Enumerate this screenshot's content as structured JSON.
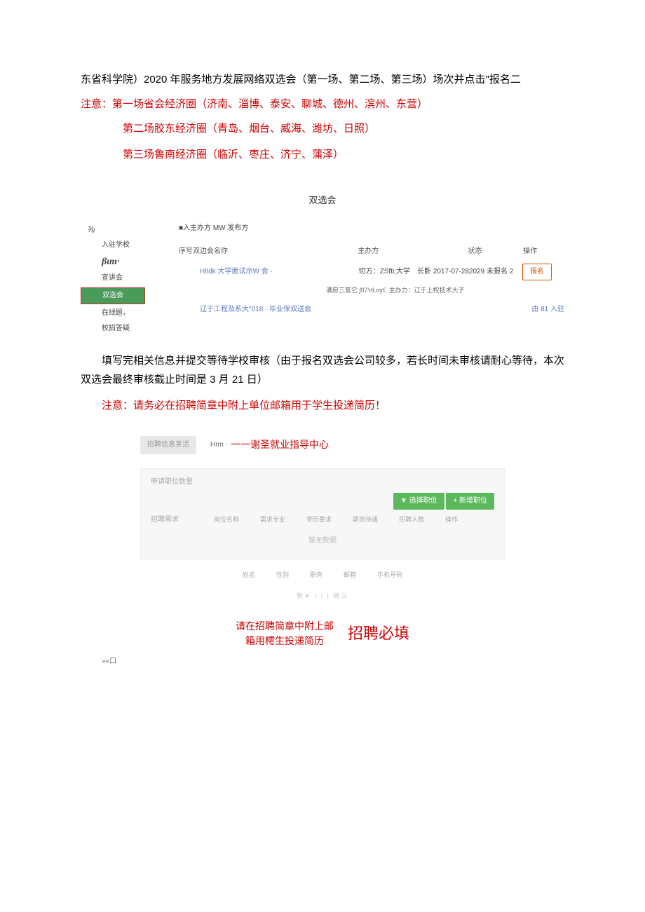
{
  "intro": {
    "line1": "东省科学院）2020 年服务地方发展网络双选会（第一场、第二场、第三场）场次并点击\"报名二",
    "notice_prefix": "注意：",
    "notice1": "第一场省会经济圈（济南、淄博、泰安、聊城、德州、滨州、东营）",
    "notice2": "第二场胶东经济圈（青岛、烟台、威海、潍坊、日照）",
    "notice3": "第三场鲁南经济圈（临沂、枣庄、济宁、蒲泽）"
  },
  "section_header": "双选会",
  "sidebar": {
    "fraction": "⅜",
    "item1": "入驻学校",
    "beta": "βιm·",
    "item2": "宣讲会",
    "active": "双选会",
    "item3": "在线题，",
    "item4": "校招答疑"
  },
  "table": {
    "filter_label": "■入主办方 MW 发布方",
    "h1": "序号双边会名你",
    "h2": "主办方",
    "h3": "状态",
    "h4": "操作",
    "row1": {
      "name": "Hltdk 大学面试示W 会 ·",
      "host_prefix": "切方：",
      "host": "ZSfti;大学",
      "date": "长卧 2017-07-282029 未报名 2",
      "action": "报名"
    },
    "subline": "满愿三笈它  ʃ07'rtl.oyℂ 主办力：辽于上权技术大子",
    "row2": {
      "name": "辽于工程及系大\"018 · 毕业保双送会",
      "entered": "由 81 入驻"
    }
  },
  "mid_text": "填写完相关信息并提交等待学校审核（由于报名双选会公司较多，若长时间未审核请耐心等待，本次双选会最终审核截止时间是 3 月 21 日）",
  "mid_notice": "注意：请务必在招聘简章中附上单位邮箱用于学生投递简历！",
  "form": {
    "pill": "招聘信息美活",
    "hrm": "Hrm ·",
    "center_title": "一一谢圣就业指导中心",
    "apply_count_label": "申请职位数量",
    "btn_select": "▼ 选择职位",
    "btn_add": "+ 新增职位",
    "demand_label": "招聘需求",
    "col1": "岗位名称",
    "col2": "需求专业",
    "col3": "学历要求",
    "col4": "薪资待遇",
    "col5": "招聘人数",
    "col6": "操作",
    "nodata": "暂无数据",
    "c1": "姓名",
    "c2": "性别",
    "c3": "职务",
    "c4": "邮箱",
    "c5": "手机号码",
    "bottom_line": "第▼ | | | 确认"
  },
  "footer": {
    "left_line1": "请在招聘简章中附上邮",
    "left_line2": "箱用樗生投递简历",
    "big": "招聘必填",
    "corner": "»«口"
  }
}
